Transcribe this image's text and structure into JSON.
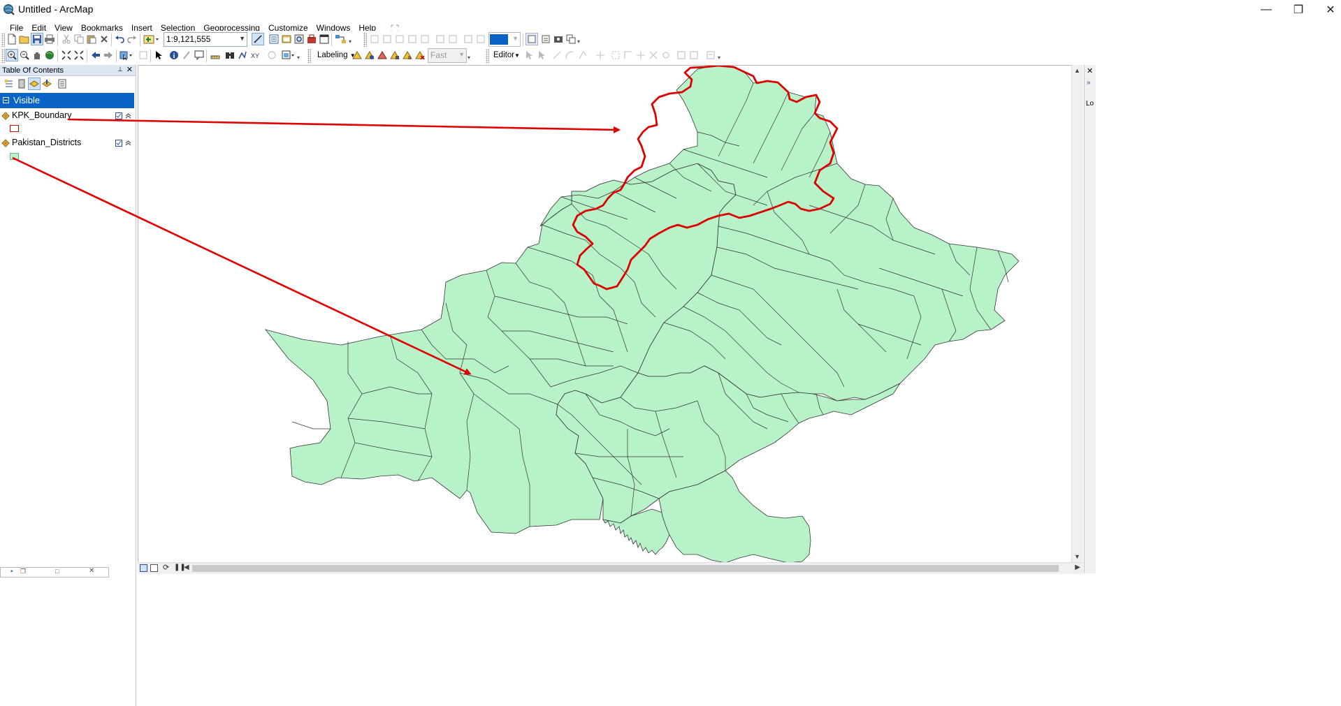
{
  "window": {
    "title": "Untitled - ArcMap",
    "minimize_glyph": "—",
    "restore_glyph": "❐",
    "close_glyph": "✕"
  },
  "menu": [
    "File",
    "Edit",
    "View",
    "Bookmarks",
    "Insert",
    "Selection",
    "Geoprocessing",
    "Customize",
    "Windows",
    "Help"
  ],
  "standard_toolbar": {
    "scale_value": "1:9,121,555",
    "icons": [
      "new-document-icon",
      "open-icon",
      "save-icon",
      "print-icon",
      "cut-icon",
      "copy-icon",
      "paste-icon",
      "delete-icon",
      "undo-icon",
      "redo-icon",
      "add-data-icon",
      "editor-toolbar-icon",
      "table-of-contents-icon",
      "catalog-icon",
      "search-window-icon",
      "arctoolbox-icon",
      "python-window-icon",
      "model-builder-icon"
    ]
  },
  "tools_toolbar": {
    "icons": [
      "zoom-in-icon",
      "zoom-out-icon",
      "pan-icon",
      "full-extent-icon",
      "fixed-zoom-in-icon",
      "fixed-zoom-out-icon",
      "back-icon",
      "forward-icon",
      "select-features-icon",
      "clear-selection-icon",
      "select-elements-icon",
      "identify-icon",
      "hyperlink-icon",
      "html-popup-icon",
      "measure-icon",
      "find-icon",
      "find-route-icon",
      "go-to-xy-icon",
      "time-slider-icon",
      "viewer-window-icon"
    ]
  },
  "labeling_toolbar": {
    "label": "Labeling",
    "quality_value": "Fast"
  },
  "editor_toolbar": {
    "label": "Editor"
  },
  "toc": {
    "title": "Table Of Contents",
    "pin_glyph": "📌",
    "close_glyph": "✕",
    "group_label": "Visible",
    "layers": [
      {
        "name": "KPK_Boundary",
        "symbol": "hollow-red-polygon"
      },
      {
        "name": "Pakistan_Districts",
        "symbol": "green-fill-polygon"
      }
    ]
  },
  "right_dock": {
    "label": "Lo"
  },
  "colors": {
    "district_fill": "#b8f2c8",
    "district_stroke": "#333333",
    "kpk_boundary": "#dd0000",
    "annotation_arrow": "#e00000",
    "selected_group": "#0a64c8"
  }
}
